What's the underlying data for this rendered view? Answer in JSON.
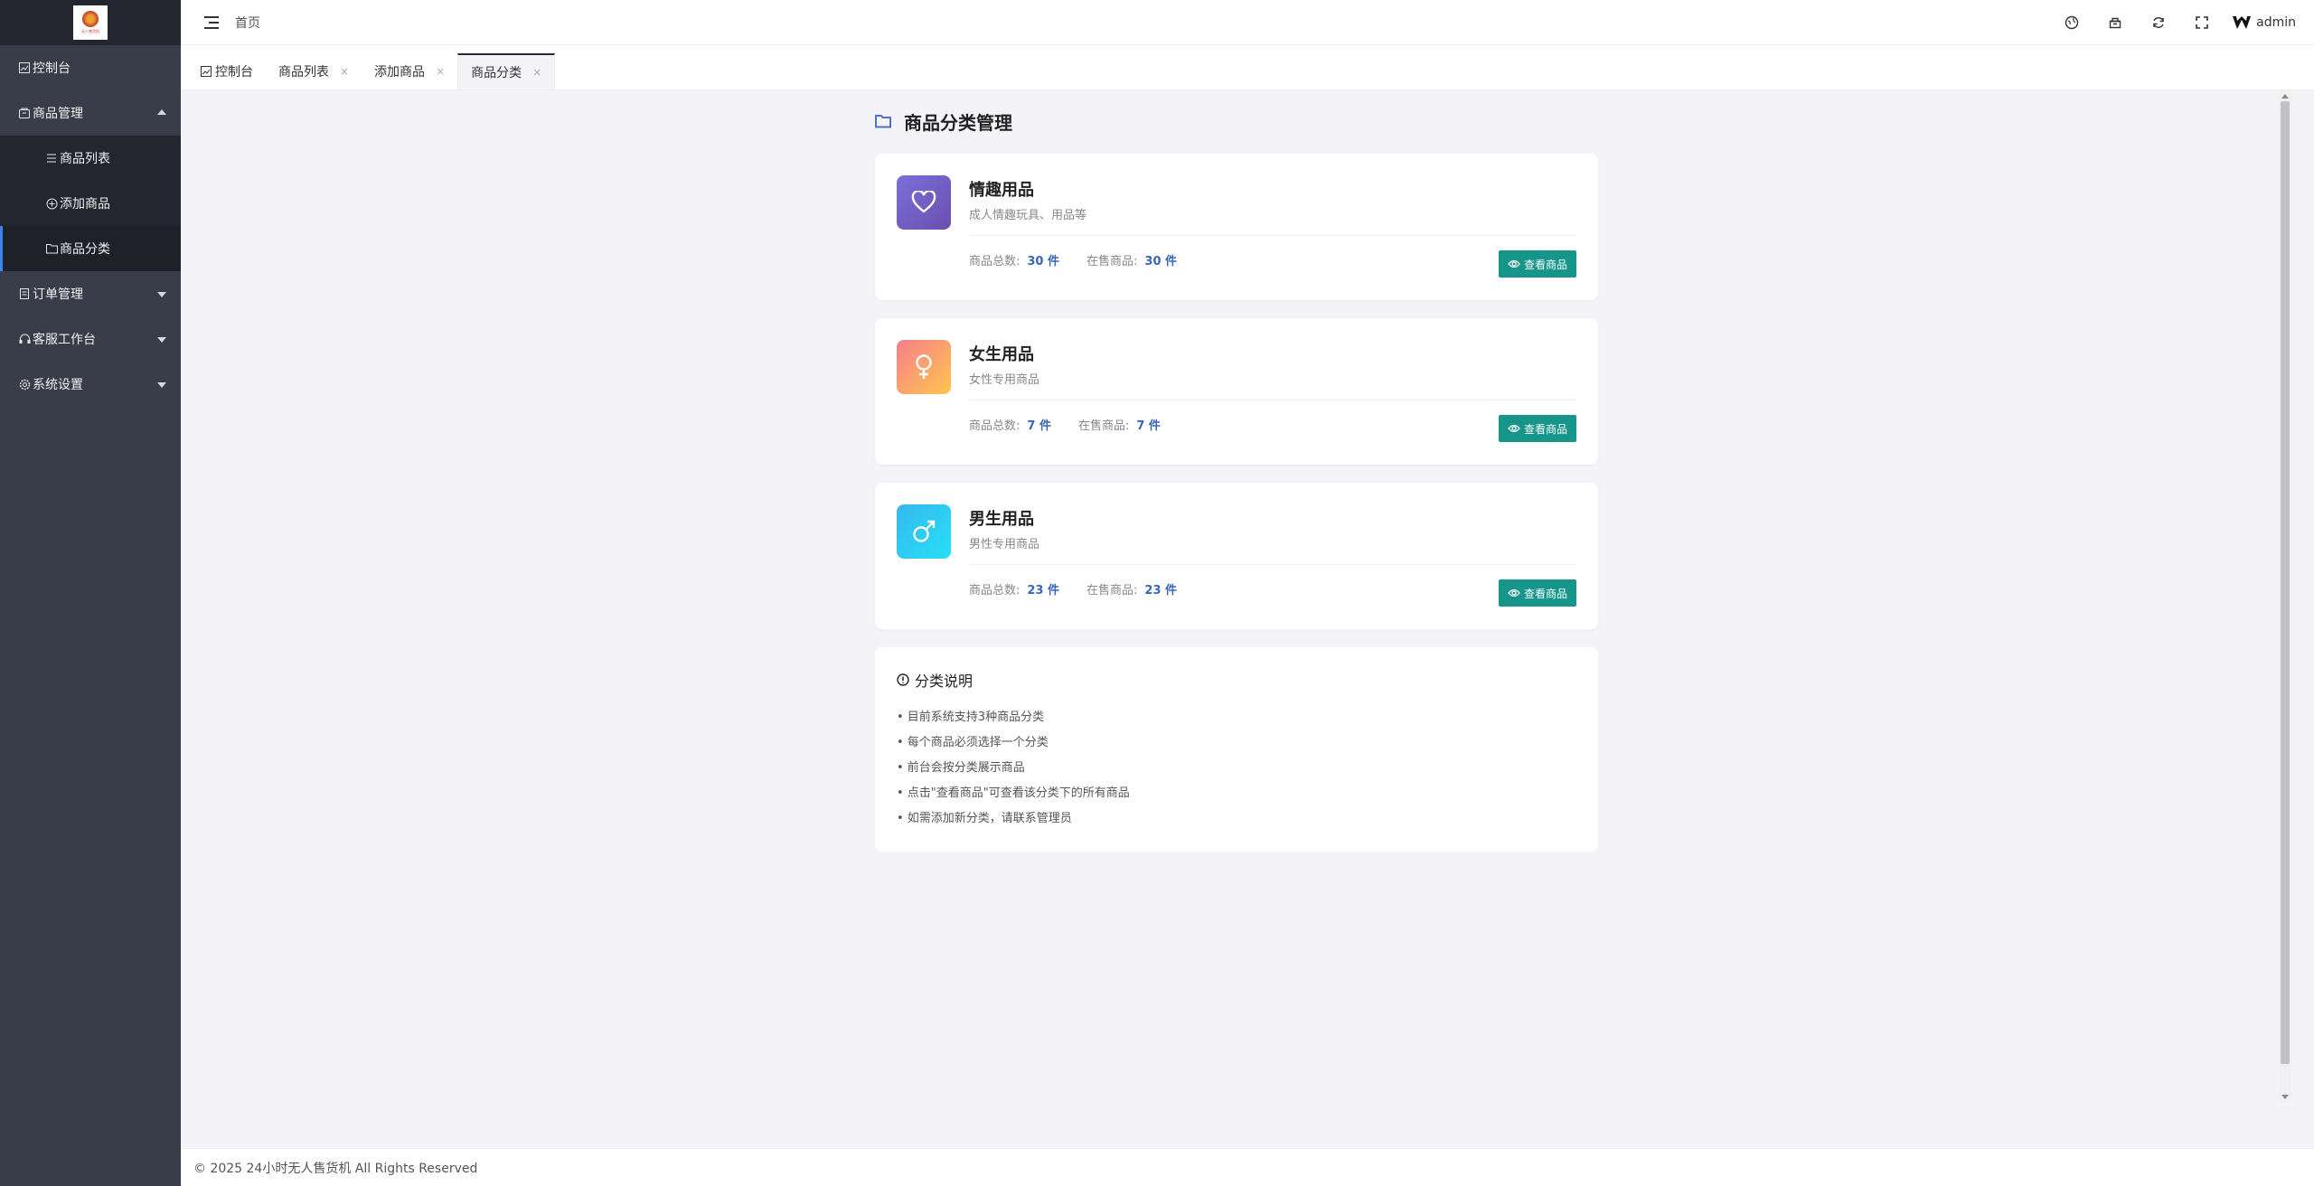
{
  "sidebar": {
    "logo_text": "无人售货机",
    "items": [
      {
        "label": "控制台"
      },
      {
        "label": "商品管理"
      },
      {
        "label": "订单管理"
      },
      {
        "label": "客服工作台"
      },
      {
        "label": "系统设置"
      }
    ],
    "sub_items": [
      {
        "label": "商品列表"
      },
      {
        "label": "添加商品"
      },
      {
        "label": "商品分类"
      }
    ]
  },
  "header": {
    "home": "首页",
    "user": "admin"
  },
  "tabs": [
    {
      "label": "控制台"
    },
    {
      "label": "商品列表"
    },
    {
      "label": "添加商品"
    },
    {
      "label": "商品分类"
    }
  ],
  "tab_close": "×",
  "page": {
    "title": "商品分类管理"
  },
  "categories": [
    {
      "name": "情趣用品",
      "desc": "成人情趣玩具、用品等",
      "total_label": "商品总数:",
      "total": "30 件",
      "onsale_label": "在售商品:",
      "onsale": "30 件",
      "btn": "查看商品"
    },
    {
      "name": "女生用品",
      "desc": "女性专用商品",
      "total_label": "商品总数:",
      "total": "7 件",
      "onsale_label": "在售商品:",
      "onsale": "7 件",
      "btn": "查看商品"
    },
    {
      "name": "男生用品",
      "desc": "男性专用商品",
      "total_label": "商品总数:",
      "total": "23 件",
      "onsale_label": "在售商品:",
      "onsale": "23 件",
      "btn": "查看商品"
    }
  ],
  "info": {
    "title": "分类说明",
    "items": [
      "• 目前系统支持3种商品分类",
      "• 每个商品必须选择一个分类",
      "• 前台会按分类展示商品",
      "• 点击\"查看商品\"可查看该分类下的所有商品",
      "• 如需添加新分类，请联系管理员"
    ]
  },
  "footer": {
    "text": "© 2025 24小时无人售货机 All Rights Reserved"
  },
  "colors": {
    "sidebar_bg": "#393d49",
    "accent_btn": "#16968a",
    "stat_value": "#3867b8"
  }
}
